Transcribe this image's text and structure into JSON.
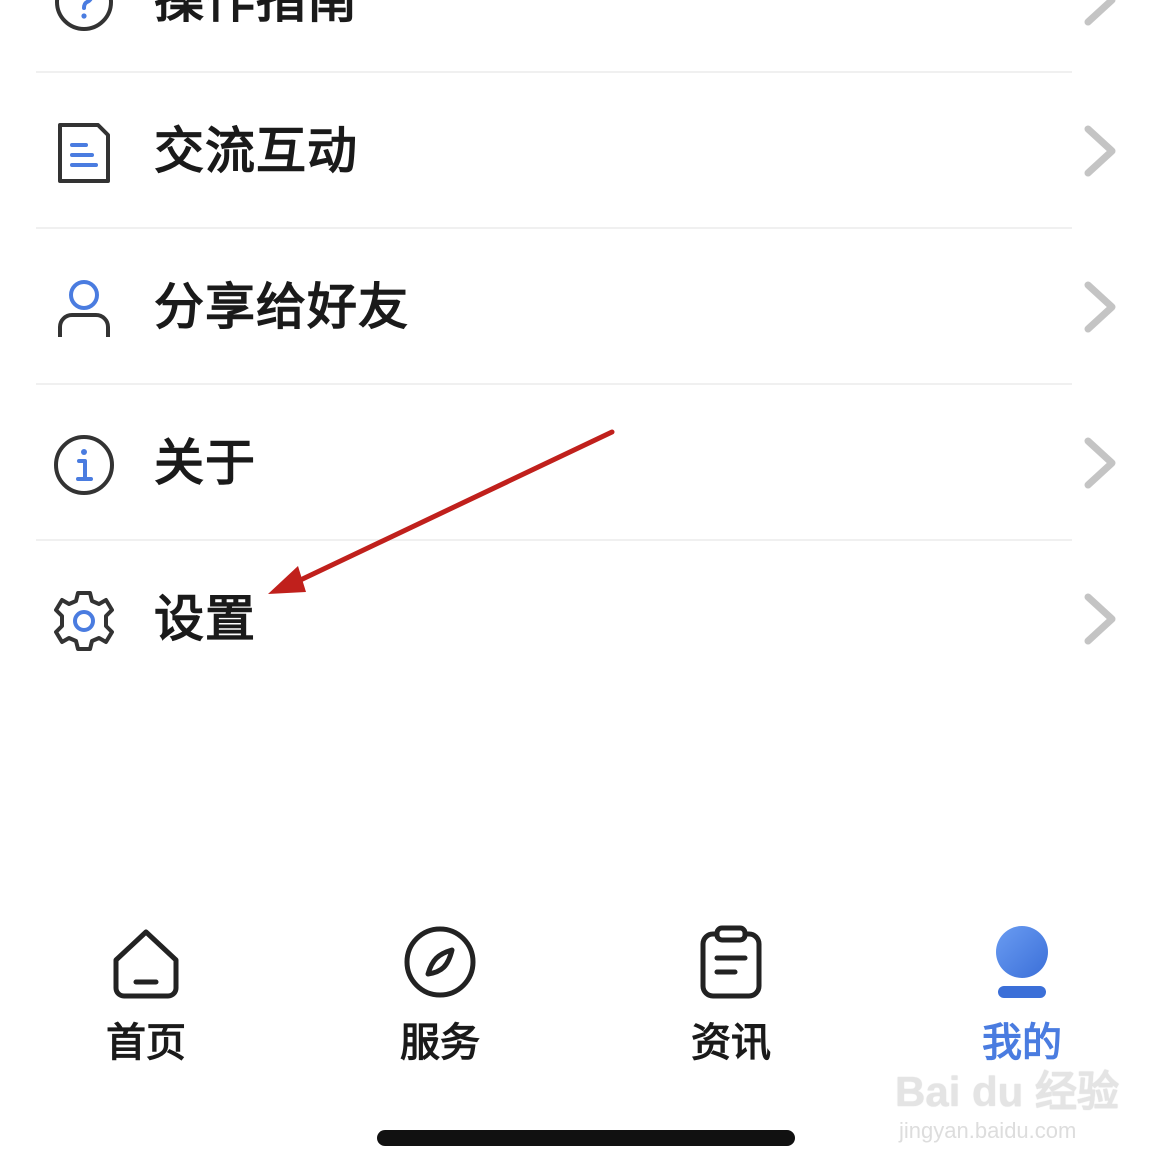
{
  "menu": {
    "items": [
      {
        "label": "操作指南",
        "icon": "question-circle-icon"
      },
      {
        "label": "交流互动",
        "icon": "document-icon"
      },
      {
        "label": "分享给好友",
        "icon": "user-icon"
      },
      {
        "label": "关于",
        "icon": "info-circle-icon"
      },
      {
        "label": "设置",
        "icon": "gear-icon"
      }
    ]
  },
  "tabbar": {
    "tabs": [
      {
        "label": "首页",
        "icon": "home-icon",
        "active": false
      },
      {
        "label": "服务",
        "icon": "compass-icon",
        "active": false
      },
      {
        "label": "资讯",
        "icon": "clipboard-icon",
        "active": false
      },
      {
        "label": "我的",
        "icon": "profile-icon",
        "active": true
      }
    ]
  },
  "watermark": {
    "logo": "Bai du 经验",
    "url": "jingyan.baidu.com"
  },
  "colors": {
    "accent": "#4a7ce0",
    "icon_stroke": "#333333",
    "chevron": "#c4c4c4",
    "divider": "#f0f0f0",
    "annotation": "#c0201c"
  }
}
